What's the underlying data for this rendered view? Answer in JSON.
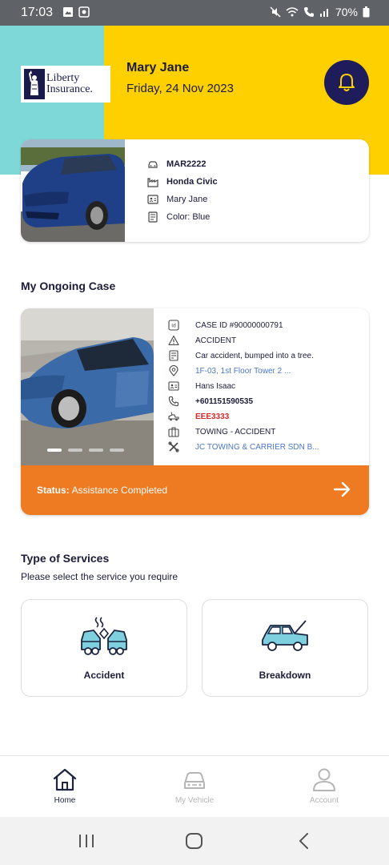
{
  "status_bar": {
    "time": "17:03",
    "battery": "70%"
  },
  "header": {
    "logo_text_line1": "Liberty",
    "logo_text_line2": "Insurance.",
    "user_name": "Mary Jane",
    "date": "Friday, 24 Nov 2023",
    "colors": {
      "yellow": "#ffd000",
      "teal": "#7fd8d8",
      "navy": "#1f1c5c"
    }
  },
  "vehicle": {
    "plate": "MAR2222",
    "model": "Honda Civic",
    "owner": "Mary Jane",
    "color": "Color: Blue"
  },
  "ongoing_case": {
    "section_title": "My Ongoing Case",
    "case_id": "CASE ID #90000000791",
    "type": "ACCIDENT",
    "description": "Car accident, bumped into a tree.",
    "location": "1F-03, 1st Floor Tower 2 ...",
    "contact_name": "Hans Isaac",
    "phone": "+601151590535",
    "tow_plate": "EEE3333",
    "service": "TOWING - ACCIDENT",
    "company": "JC TOWING & CARRIER SDN B...",
    "status_label": "Status:",
    "status_value": "Assistance Completed",
    "status_color": "#ee7a22",
    "carousel_pages": 4,
    "carousel_active": 1
  },
  "services": {
    "title": "Type of Services",
    "subtitle": "Please select the service you require",
    "items": [
      {
        "label": "Accident",
        "icon": "car-crash-icon"
      },
      {
        "label": "Breakdown",
        "icon": "car-breakdown-icon"
      }
    ]
  },
  "bottom_nav": {
    "items": [
      {
        "label": "Home",
        "icon": "home-icon",
        "active": true
      },
      {
        "label": "My Vehicle",
        "icon": "car-icon",
        "active": false
      },
      {
        "label": "Account",
        "icon": "user-icon",
        "active": false
      }
    ]
  }
}
